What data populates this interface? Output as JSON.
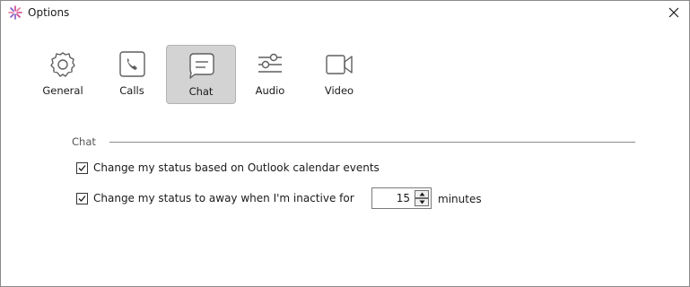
{
  "window": {
    "title": "Options",
    "icon": "star-logo-icon",
    "close_icon": "close-icon"
  },
  "tabs": [
    {
      "label": "General",
      "icon": "gear-icon",
      "selected": false
    },
    {
      "label": "Calls",
      "icon": "phone-icon",
      "selected": false
    },
    {
      "label": "Chat",
      "icon": "chat-bubble-icon",
      "selected": true
    },
    {
      "label": "Audio",
      "icon": "audio-sliders-icon",
      "selected": false
    },
    {
      "label": "Video",
      "icon": "video-camera-icon",
      "selected": false
    }
  ],
  "section": {
    "title": "Chat"
  },
  "options": [
    {
      "label": "Change my status based on Outlook calendar events",
      "checked": true
    },
    {
      "label": "Change my status to away when I'm inactive for",
      "checked": true
    }
  ],
  "inactive_timeout": {
    "value": "15",
    "units": "minutes"
  },
  "colors": {
    "selected_tab_bg": "#d3d3d3",
    "icon_stroke": "#5f5f5f",
    "logo_pink": "#d0408e",
    "logo_purple": "#7e57c2"
  }
}
